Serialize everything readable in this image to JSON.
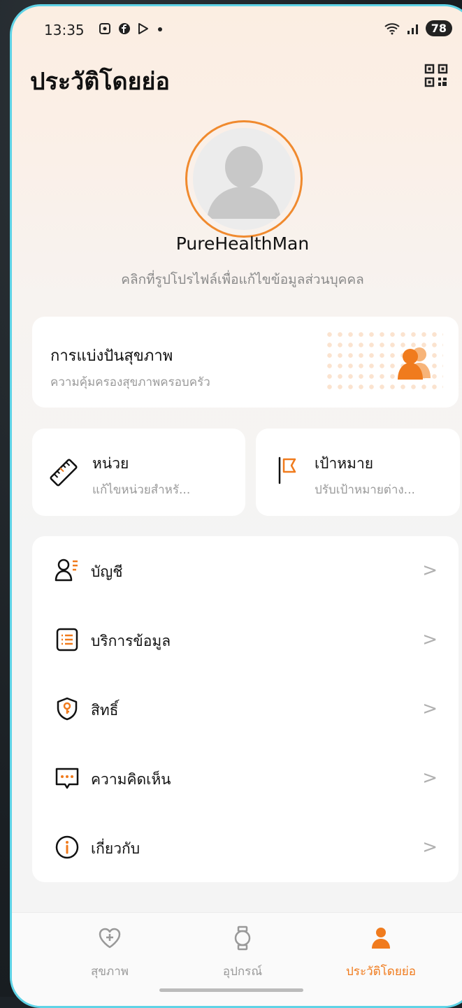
{
  "status_bar": {
    "time": "13:35",
    "battery": "78"
  },
  "header": {
    "title": "ประวัติโดยย่อ"
  },
  "profile": {
    "username": "PureHealthMan",
    "hint": "คลิกที่รูปโปรไฟล์เพื่อแก้ไขข้อมูลส่วนบุคคล"
  },
  "health_share": {
    "title": "การแบ่งปันสุขภาพ",
    "subtitle": "ความคุ้มครองสุขภาพครอบครัว"
  },
  "tiles": {
    "unit": {
      "title": "หน่วย",
      "subtitle": "แก้ไขหน่วยสำหรั..."
    },
    "goal": {
      "title": "เป้าหมาย",
      "subtitle": "ปรับเป้าหมายต่าง..."
    }
  },
  "menu": {
    "items": [
      {
        "label": "บัญชี",
        "icon": "account-icon"
      },
      {
        "label": "บริการข้อมูล",
        "icon": "data-service-icon"
      },
      {
        "label": "สิทธิ์",
        "icon": "permission-shield-icon"
      },
      {
        "label": "ความคิดเห็น",
        "icon": "feedback-icon"
      },
      {
        "label": "เกี่ยวกับ",
        "icon": "info-icon"
      }
    ],
    "chevron": ">"
  },
  "bottom_nav": {
    "items": [
      {
        "label": "สุขภาพ",
        "active": false
      },
      {
        "label": "อุปกรณ์",
        "active": false
      },
      {
        "label": "ประวัติโดยย่อ",
        "active": true
      }
    ]
  },
  "colors": {
    "accent": "#f07b1d",
    "ring": "#f08a2e",
    "frame": "#5fd3e6"
  }
}
